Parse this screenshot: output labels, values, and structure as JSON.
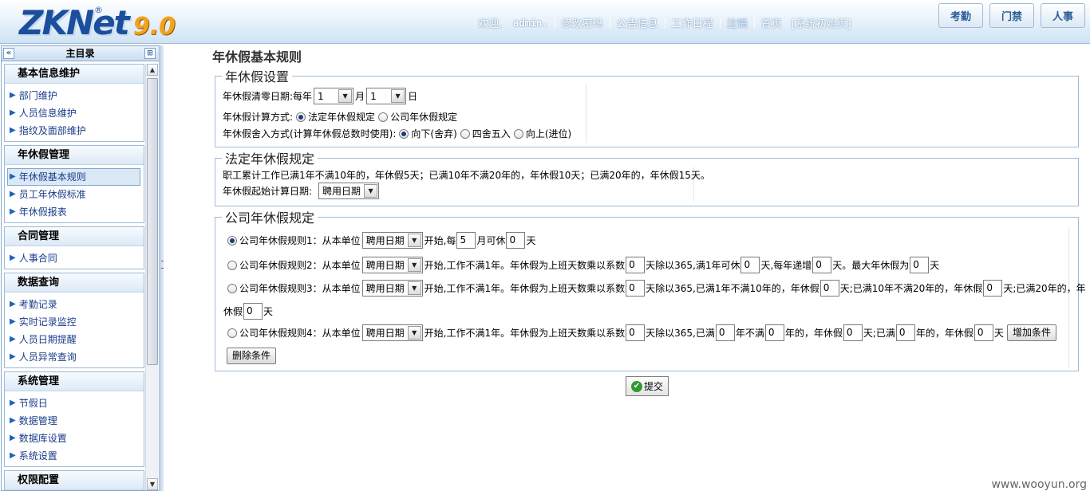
{
  "header": {
    "logo_main": "ZKNet",
    "logo_version": "9.0",
    "logo_reg": "®",
    "welcome": "欢迎,",
    "user": "admin.",
    "links": [
      "修改密码",
      "公告信息",
      "工作日程",
      "注销",
      "首页"
    ],
    "sys_home": "[系统初始页]",
    "buttons": [
      "考勤",
      "门禁",
      "人事"
    ]
  },
  "sidebar": {
    "title": "主目录",
    "collapse_glyph": "«",
    "pin_glyph": "⊞",
    "groups": [
      {
        "title": "基本信息维护",
        "items": [
          "部门维护",
          "人员信息维护",
          "指纹及面部维护"
        ]
      },
      {
        "title": "年休假管理",
        "items": [
          "年休假基本规则",
          "员工年休假标准",
          "年休假报表"
        ]
      },
      {
        "title": "合同管理",
        "items": [
          "人事合同"
        ]
      },
      {
        "title": "数据查询",
        "items": [
          "考勤记录",
          "实时记录监控",
          "人员日期提醒",
          "人员异常查询"
        ]
      },
      {
        "title": "系统管理",
        "items": [
          "节假日",
          "数据管理",
          "数据库设置",
          "系统设置"
        ]
      },
      {
        "title": "权限配置",
        "items": []
      }
    ]
  },
  "main": {
    "page_title": "年休假基本规则",
    "settings": {
      "legend": "年休假设置",
      "reset_label": "年休假清零日期:每年",
      "month_value": "1",
      "month_unit": "月",
      "day_value": "1",
      "day_unit": "日",
      "calc_label": "年休假计算方式:",
      "calc_opt1": "法定年休假规定",
      "calc_opt2": "公司年休假规定",
      "round_label": "年休假舍入方式(计算年休假总数时使用):",
      "round_opt1": "向下(舍弃)",
      "round_opt2": "四舍五入",
      "round_opt3": "向上(进位)"
    },
    "legal": {
      "legend": "法定年休假规定",
      "desc": "职工累计工作已满1年不满10年的，年休假5天；已满10年不满20年的，年休假10天；已满20年的，年休假15天。",
      "start_label": "年休假起始计算日期:",
      "start_value": "聘用日期"
    },
    "company": {
      "legend": "公司年休假规定",
      "r1": {
        "label": "公司年休假规则1：从本单位",
        "sel": "聘用日期",
        "t1": "开始,每",
        "v1": "5",
        "t2": "月可休",
        "v2": "0",
        "t3": "天"
      },
      "r2": {
        "label": "公司年休假规则2：从本单位",
        "sel": "聘用日期",
        "t1": "开始,工作不满1年。年休假为上班天数乘以系数",
        "v1": "0",
        "t2": "天除以365,满1年可休",
        "v2": "0",
        "t3": "天,每年递增",
        "v3": "0",
        "t4": "天。最大年休假为",
        "v4": "0",
        "t5": "天"
      },
      "r3": {
        "label": "公司年休假规则3：从本单位",
        "sel": "聘用日期",
        "t1": "开始,工作不满1年。年休假为上班天数乘以系数",
        "v1": "0",
        "t2": "天除以365,已满1年不满10年的，年休假",
        "v2": "0",
        "t3": "天;已满10年不满20年的，年休假",
        "v3": "0",
        "t4": "天;已满20年的，年",
        "t5": "休假",
        "v4": "0",
        "t6": "天"
      },
      "r4": {
        "label": "公司年休假规则4：从本单位",
        "sel": "聘用日期",
        "t1": "开始,工作不满1年。年休假为上班天数乘以系数",
        "v1": "0",
        "t2": "天除以365,已满",
        "v2": "0",
        "t3": "年不满",
        "v3": "0",
        "t4": "年的，年休假",
        "v4": "0",
        "t5": "天;已满",
        "v5": "0",
        "t6": "年的，年休假",
        "v6": "0",
        "t7": "天"
      },
      "add_button": "增加条件",
      "delete_button": "删除条件"
    },
    "submit": "提交"
  },
  "watermark": "www.wooyun.org"
}
